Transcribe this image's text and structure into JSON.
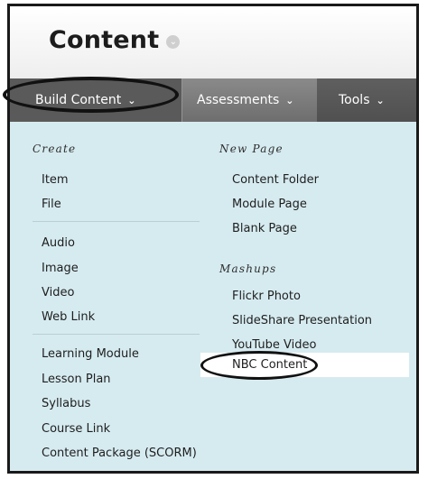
{
  "header": {
    "title": "Content"
  },
  "toolbar": {
    "build_content": "Build Content",
    "assessments": "Assessments",
    "tools": "Tools",
    "chevron": "⌄"
  },
  "menu": {
    "create": {
      "heading": "Create",
      "group1": [
        "Item",
        "File"
      ],
      "group2": [
        "Audio",
        "Image",
        "Video",
        "Web Link"
      ],
      "group3": [
        "Learning Module",
        "Lesson Plan",
        "Syllabus",
        "Course Link",
        "Content Package (SCORM)"
      ]
    },
    "new_page": {
      "heading": "New Page",
      "items": [
        "Content Folder",
        "Module Page",
        "Blank Page"
      ]
    },
    "mashups": {
      "heading": "Mashups",
      "items": [
        "Flickr Photo",
        "SlideShare Presentation",
        "YouTube Video",
        "NBC Content"
      ]
    }
  },
  "colors": {
    "menu_background": "#d6ebf0",
    "toolbar_background": "#6e6e6e",
    "active_tab": "#5a5a5a",
    "selected_row": "#ffffff"
  }
}
